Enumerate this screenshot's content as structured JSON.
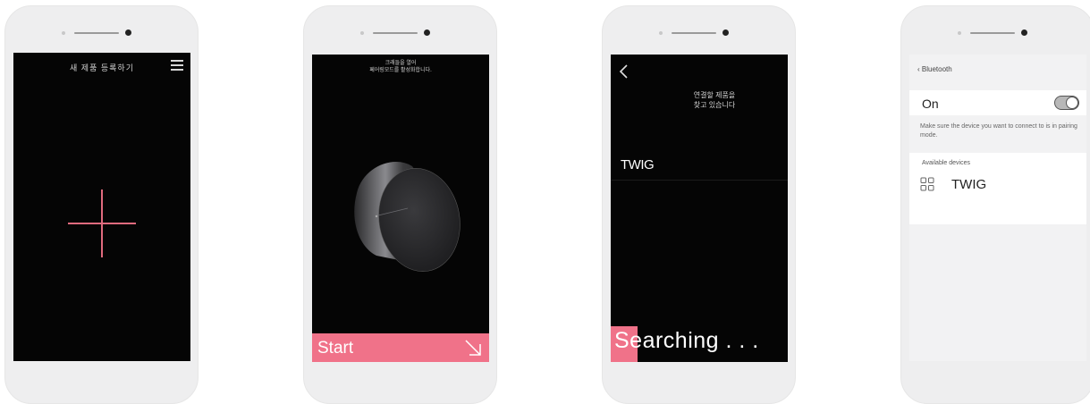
{
  "screen1": {
    "title": "새 제품 등록하기"
  },
  "screen2": {
    "instruction_line1": "크래들을 열어",
    "instruction_line2": "페어링모드를 활성화합니다.",
    "start_label": "Start"
  },
  "screen3": {
    "status_line1": "연결할 제품을",
    "status_line2": "찾고 있습니다",
    "device_name": "TWIG",
    "searching_label": "Searching . . ."
  },
  "screen4": {
    "back_label": "Bluetooth",
    "on_label": "On",
    "hint": "Make sure the device you want to connect to is in pairing mode.",
    "available_heading": "Available devices",
    "device_name": "TWIG"
  },
  "colors": {
    "accent": "#f07289",
    "dark_bg": "#050505",
    "phone_body": "#eeeeef"
  },
  "icons": [
    "hamburger-menu-icon",
    "plus-icon",
    "arrow-down-right-icon",
    "chevron-left-icon",
    "device-grid-icon"
  ]
}
